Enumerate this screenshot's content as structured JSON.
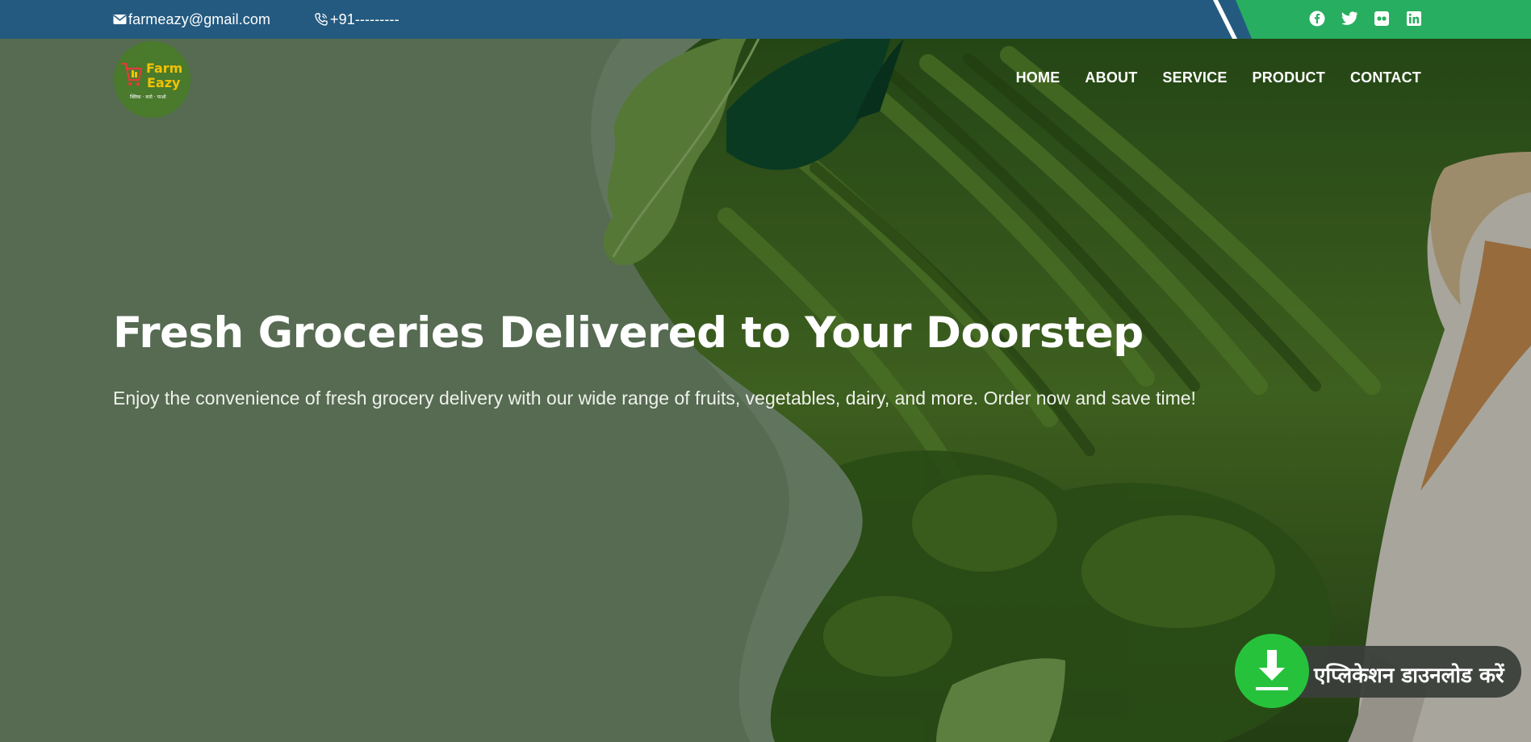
{
  "topbar": {
    "email": "farmeazy@gmail.com",
    "phone": "+91---------",
    "social": [
      "facebook-icon",
      "twitter-icon",
      "flickr-icon",
      "linkedin-icon"
    ],
    "colors": {
      "left": "#245a80",
      "right": "#27ae60"
    }
  },
  "logo": {
    "line1": "Farm",
    "line2": "Eazy",
    "tagline": "क्लिक · करो · पाओ"
  },
  "nav": {
    "items": [
      {
        "label": "HOME"
      },
      {
        "label": "ABOUT"
      },
      {
        "label": "SERVICE"
      },
      {
        "label": "PRODUCT"
      },
      {
        "label": "CONTACT"
      }
    ]
  },
  "hero": {
    "title": "Fresh Groceries Delivered to Your Doorstep",
    "subtitle": "Enjoy the convenience of fresh grocery delivery with our wide range of fruits, vegetables, dairy, and more. Order now and save time!"
  },
  "download_badge": {
    "label": "एप्लिकेशन डाउनलोड करें",
    "accent": "#27c23c"
  }
}
